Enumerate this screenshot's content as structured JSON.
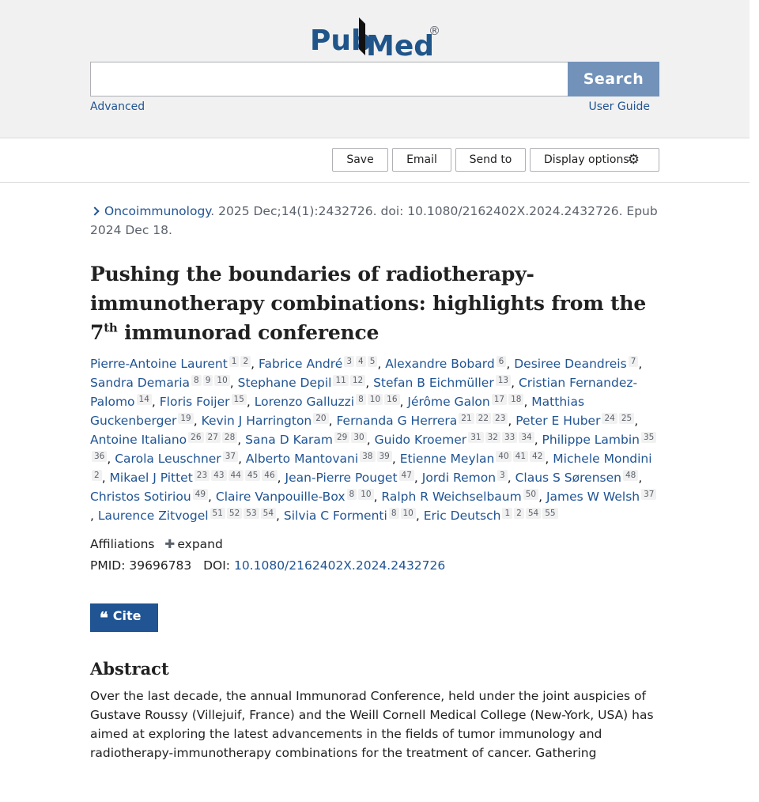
{
  "header": {
    "logo_pub": "Pub",
    "logo_med": "Med",
    "logo_reg": "®",
    "search_value": "",
    "search_button": "Search",
    "advanced": "Advanced",
    "user_guide": "User Guide",
    "colors": {
      "background": "#f1f1f1",
      "search_button": "#7292b9",
      "link": "#205493",
      "logo_blue": "#20558a"
    }
  },
  "toolbar": {
    "save": "Save",
    "email": "Email",
    "send_to": "Send to",
    "display_options": "Display options",
    "gear_icon": "gear-icon"
  },
  "article": {
    "journal": "Oncoimmunology",
    "citation_rest": ". 2025 Dec;14(1):2432726. doi: 10.1080/2162402X.2024.2432726. Epub 2024 Dec 18.",
    "title_part1": "Pushing the boundaries of radiotherapy-immunotherapy combinations: highlights from the 7",
    "title_sup": "th",
    "title_part2": " immunorad conference",
    "authors": [
      {
        "name": "Pierre-Antoine Laurent",
        "affs": [
          "1",
          "2"
        ]
      },
      {
        "name": "Fabrice André",
        "affs": [
          "3",
          "4",
          "5"
        ]
      },
      {
        "name": "Alexandre Bobard",
        "affs": [
          "6"
        ]
      },
      {
        "name": "Desiree Deandreis",
        "affs": [
          "7"
        ]
      },
      {
        "name": "Sandra Demaria",
        "affs": [
          "8",
          "9",
          "10"
        ]
      },
      {
        "name": "Stephane Depil",
        "affs": [
          "11",
          "12"
        ]
      },
      {
        "name": "Stefan B Eichmüller",
        "affs": [
          "13"
        ]
      },
      {
        "name": "Cristian Fernandez-Palomo",
        "affs": [
          "14"
        ]
      },
      {
        "name": "Floris Foijer",
        "affs": [
          "15"
        ]
      },
      {
        "name": "Lorenzo Galluzzi",
        "affs": [
          "8",
          "10",
          "16"
        ]
      },
      {
        "name": "Jérôme Galon",
        "affs": [
          "17",
          "18"
        ]
      },
      {
        "name": "Matthias Guckenberger",
        "affs": [
          "19"
        ]
      },
      {
        "name": "Kevin J Harrington",
        "affs": [
          "20"
        ]
      },
      {
        "name": "Fernanda G Herrera",
        "affs": [
          "21",
          "22",
          "23"
        ]
      },
      {
        "name": "Peter E Huber",
        "affs": [
          "24",
          "25"
        ]
      },
      {
        "name": "Antoine Italiano",
        "affs": [
          "26",
          "27",
          "28"
        ]
      },
      {
        "name": "Sana D Karam",
        "affs": [
          "29",
          "30"
        ]
      },
      {
        "name": "Guido Kroemer",
        "affs": [
          "31",
          "32",
          "33",
          "34"
        ]
      },
      {
        "name": "Philippe Lambin",
        "affs": [
          "35",
          "36"
        ]
      },
      {
        "name": "Carola Leuschner",
        "affs": [
          "37"
        ]
      },
      {
        "name": "Alberto Mantovani",
        "affs": [
          "38",
          "39"
        ]
      },
      {
        "name": "Etienne Meylan",
        "affs": [
          "40",
          "41",
          "42"
        ]
      },
      {
        "name": "Michele Mondini",
        "affs": [
          "2"
        ]
      },
      {
        "name": "Mikael J Pittet",
        "affs": [
          "23",
          "43",
          "44",
          "45",
          "46"
        ]
      },
      {
        "name": "Jean-Pierre Pouget",
        "affs": [
          "47"
        ]
      },
      {
        "name": "Jordi Remon",
        "affs": [
          "3"
        ]
      },
      {
        "name": "Claus S Sørensen",
        "affs": [
          "48"
        ]
      },
      {
        "name": "Christos Sotiriou",
        "affs": [
          "49"
        ]
      },
      {
        "name": "Claire Vanpouille-Box",
        "affs": [
          "8",
          "10"
        ]
      },
      {
        "name": "Ralph R Weichselbaum",
        "affs": [
          "50"
        ]
      },
      {
        "name": "James W Welsh",
        "affs": [
          "37"
        ]
      },
      {
        "name": "Laurence Zitvogel",
        "affs": [
          "51",
          "52",
          "53",
          "54"
        ]
      },
      {
        "name": "Silvia C Formenti",
        "affs": [
          "8",
          "10"
        ]
      },
      {
        "name": "Eric Deutsch",
        "affs": [
          "1",
          "2",
          "54",
          "55"
        ]
      }
    ],
    "affiliations_label": "Affiliations",
    "expand_label": "expand",
    "pmid_label": "PMID:",
    "pmid": "39696783",
    "doi_label": "DOI:",
    "doi": "10.1080/2162402X.2024.2432726",
    "cite_label": "Cite",
    "abstract_heading": "Abstract",
    "abstract_text": "Over the last decade, the annual Immunorad Conference, held under the joint auspicies of Gustave Roussy (Villejuif, France) and the Weill Cornell Medical College (New-York, USA) has aimed at exploring the latest advancements in the fields of tumor immunology and radiotherapy-immunotherapy combinations for the treatment of cancer. Gathering"
  }
}
